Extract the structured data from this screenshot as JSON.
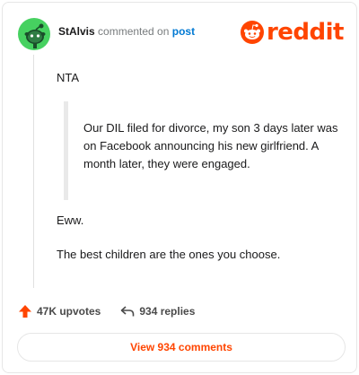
{
  "comment": {
    "username": "StAlvis",
    "action_text": "commented on",
    "post_link": "post",
    "body": {
      "paragraph1": "NTA",
      "quote": "Our DIL filed for divorce, my son 3 days later was on Facebook announcing his new girlfriend. A month later, they were engaged.",
      "paragraph2": "Eww.",
      "paragraph3": "The best children are the ones you choose."
    }
  },
  "logo": {
    "text": "reddit",
    "color": "#ff4500"
  },
  "actions": {
    "upvotes": "47K upvotes",
    "replies": "934 replies"
  },
  "footer": {
    "view_comments": "View 934 comments"
  },
  "colors": {
    "accent": "#ff4500",
    "link": "#0079d3",
    "avatar": "#46d160"
  }
}
